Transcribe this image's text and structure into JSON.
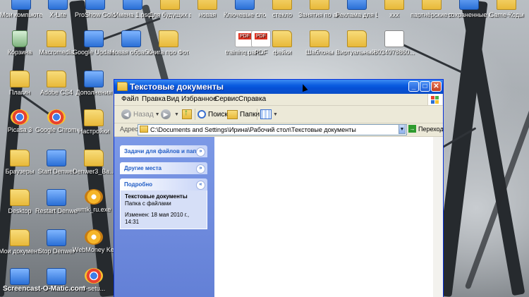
{
  "desktop": {
    "icons": [
      {
        "label": "Мои компьютер",
        "kind": "app"
      },
      {
        "label": "X-Lite",
        "kind": "app"
      },
      {
        "label": "ProShow Gold",
        "kind": "app"
      },
      {
        "label": "Имена 1.psd",
        "kind": "app"
      },
      {
        "label": "Для будущих видеоуроков",
        "kind": "folder"
      },
      {
        "label": "новая",
        "kind": "folder"
      },
      {
        "label": "Ключевые слова.doc",
        "kind": "app"
      },
      {
        "label": "стекло",
        "kind": "folder"
      },
      {
        "label": "Занятия по английскому",
        "kind": "folder"
      },
      {
        "label": "Реклама для Live Works",
        "kind": "app"
      },
      {
        "label": "xxx",
        "kind": "folder"
      },
      {
        "label": "партнёрские проекты",
        "kind": "folder"
      },
      {
        "label": "сохраненные пароли.txt",
        "kind": "app"
      },
      {
        "label": "Game-Коды",
        "kind": "folder"
      },
      {
        "label": "Корзина",
        "kind": "bin"
      },
      {
        "label": "Macromedia",
        "kind": "folder"
      },
      {
        "label": "Google Updater.exe",
        "kind": "app"
      },
      {
        "label": "Новая обработка.zip",
        "kind": "app"
      },
      {
        "label": "Книга про Фотошоп",
        "kind": "folder"
      },
      {
        "label": "training.part...",
        "kind": "pdf"
      },
      {
        "label": "PDF",
        "kind": "pdf"
      },
      {
        "label": "фейки",
        "kind": "folder"
      },
      {
        "label": "Шаблоны",
        "kind": "folder"
      },
      {
        "label": "Виртуальный Фотограф",
        "kind": "folder"
      },
      {
        "label": "8034978860...",
        "kind": "cal"
      },
      {
        "label": "Плагин",
        "kind": "folder"
      },
      {
        "label": "Adobe CS4",
        "kind": "folder"
      },
      {
        "label": "Дополнения",
        "kind": "app"
      },
      {
        "label": "Picasa 3",
        "kind": "chrome"
      },
      {
        "label": "Google Chrome",
        "kind": "chrome"
      },
      {
        "label": "Настройки",
        "kind": "folder"
      },
      {
        "label": "Браузеры",
        "kind": "folder"
      },
      {
        "label": "Start Denwer",
        "kind": "app"
      },
      {
        "label": "Denwer3_Ba...",
        "kind": "folder"
      },
      {
        "label": "Desktop",
        "kind": "folder"
      },
      {
        "label": "Restart Denwer",
        "kind": "app"
      },
      {
        "label": "wmk_ru.exe",
        "kind": "web"
      },
      {
        "label": "Мои документы",
        "kind": "folder"
      },
      {
        "label": "Stop Denwer",
        "kind": "app"
      },
      {
        "label": "WebMoney Keeper Clas...",
        "kind": "web"
      },
      {
        "label": "",
        "kind": "app"
      },
      {
        "label": "",
        "kind": "app"
      },
      {
        "label": "3-setu...",
        "kind": "chrome"
      }
    ],
    "watermark": "Screencast-O-Matic.com"
  },
  "window": {
    "title": "Текстовые документы",
    "controls": {
      "minimize": "_",
      "maximize": "□",
      "close": "✕"
    },
    "menu": [
      "Файл",
      "Правка",
      "Вид",
      "Избранное",
      "Сервис",
      "Справка"
    ],
    "toolbar": {
      "back": "Назад",
      "search": "Поиск",
      "folders": "Папки"
    },
    "address": {
      "label": "Адрес:",
      "path": "C:\\Documents and Settings\\Ирина\\Рабочий стол\\Текстовые документы",
      "go": "Переход"
    },
    "taskpane": {
      "panel1": "Задачи для файлов и папок",
      "panel2": "Другие места",
      "panel3": "Подробно",
      "details_name": "Текстовые документы",
      "details_type": "Папка с файлами",
      "details_modified": "Изменен: 18 мая 2010 г., 14:31"
    }
  },
  "colors": {
    "title_blue": "#0a5ce0",
    "taskpane_blue": "#7c99e6",
    "close_red": "#c3401f"
  }
}
